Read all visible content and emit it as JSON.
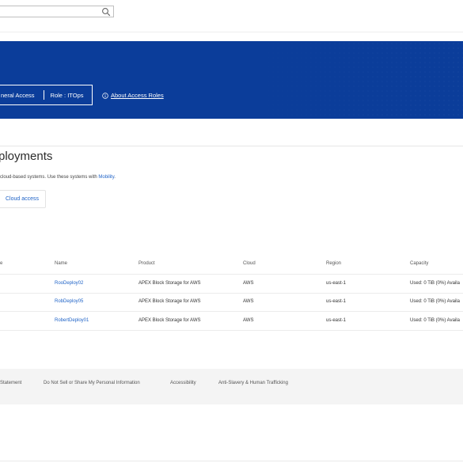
{
  "search": {
    "value": ""
  },
  "banner": {
    "access_text": "neral Access",
    "role_text": "Role : ITOps",
    "about_link": "About Access Roles"
  },
  "page": {
    "title": "ployments",
    "description_text": "cloud-based systems. Use these systems with ",
    "mobility_link": "Mobility",
    "description_end": ".",
    "cloud_access_button": "Cloud access"
  },
  "table": {
    "headers": [
      "e",
      "Name",
      "Product",
      "Cloud",
      "Region",
      "Capacity"
    ],
    "rows": [
      {
        "name": "RooDeploy02",
        "product": "APEX Block Storage for AWS",
        "cloud": "AWS",
        "region": "us-east-1",
        "capacity": "Used: 0 TiB (0%) Availa"
      },
      {
        "name": "RobDeploy05",
        "product": "APEX Block Storage for AWS",
        "cloud": "AWS",
        "region": "us-east-1",
        "capacity": "Used: 0 TiB (0%) Availa"
      },
      {
        "name": "RobertDeploy01",
        "product": "APEX Block Storage for AWS",
        "cloud": "AWS",
        "region": "us-east-1",
        "capacity": "Used: 0 TiB (0%) Availa"
      }
    ]
  },
  "footer": {
    "links": [
      "Statement",
      "Do Not Sell or Share My Personal Information",
      "Accessibility",
      "Anti-Slavery & Human Trafficking"
    ]
  },
  "colors": {
    "banner": "#0b3d9a",
    "link": "#1f63c7"
  }
}
